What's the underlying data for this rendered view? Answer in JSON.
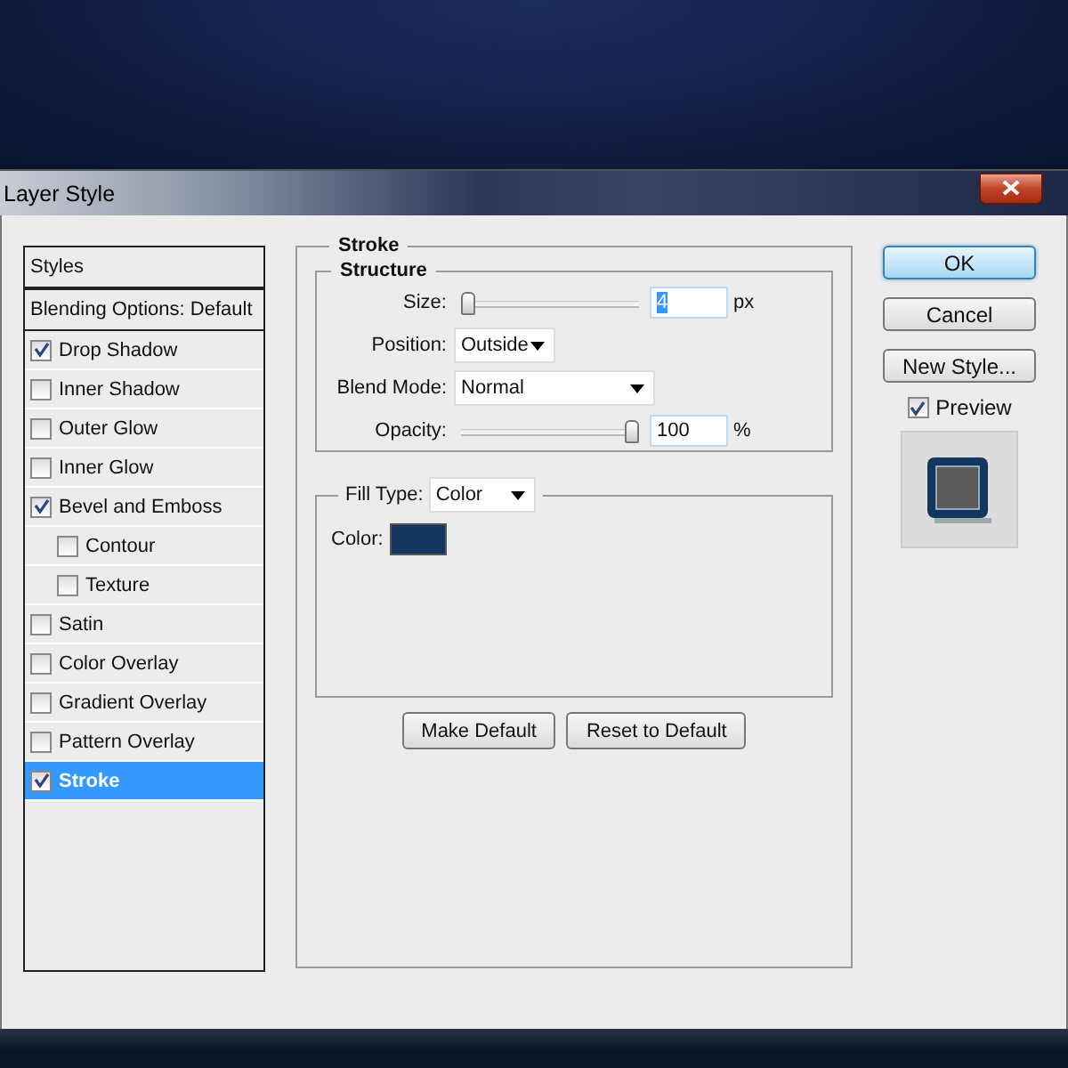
{
  "window": {
    "title": "Layer Style"
  },
  "styles_list": {
    "items": [
      {
        "kind": "header",
        "label": "Styles",
        "selected": false
      },
      {
        "kind": "option",
        "label": "Blending Options: Default",
        "selected": false
      },
      {
        "kind": "effect",
        "label": "Drop Shadow",
        "checked": true,
        "selected": false
      },
      {
        "kind": "effect",
        "label": "Inner Shadow",
        "checked": false,
        "selected": false
      },
      {
        "kind": "effect",
        "label": "Outer Glow",
        "checked": false,
        "selected": false
      },
      {
        "kind": "effect",
        "label": "Inner Glow",
        "checked": false,
        "selected": false
      },
      {
        "kind": "effect",
        "label": "Bevel and Emboss",
        "checked": true,
        "selected": false,
        "children": [
          {
            "kind": "effect",
            "label": "Contour",
            "checked": false,
            "selected": false
          },
          {
            "kind": "effect",
            "label": "Texture",
            "checked": false,
            "selected": false
          }
        ]
      },
      {
        "kind": "effect",
        "label": "Satin",
        "checked": false,
        "selected": false
      },
      {
        "kind": "effect",
        "label": "Color Overlay",
        "checked": false,
        "selected": false
      },
      {
        "kind": "effect",
        "label": "Gradient Overlay",
        "checked": false,
        "selected": false
      },
      {
        "kind": "effect",
        "label": "Pattern Overlay",
        "checked": false,
        "selected": false
      },
      {
        "kind": "effect",
        "label": "Stroke",
        "checked": true,
        "selected": true
      }
    ]
  },
  "stroke": {
    "title": "Stroke",
    "structure": {
      "title": "Structure",
      "size": {
        "label": "Size:",
        "level": 0.0,
        "value": "4",
        "unit": "px"
      },
      "position": {
        "label": "Position:",
        "value": "Outside"
      },
      "blend_mode": {
        "label": "Blend Mode:",
        "value": "Normal"
      },
      "opacity": {
        "label": "Opacity:",
        "level": 1.0,
        "value": "100",
        "unit": "%"
      }
    },
    "fill": {
      "label": "Fill Type:",
      "value": "Color",
      "color_label": "Color:",
      "color": "#12365e"
    },
    "buttons": [
      "Make Default",
      "Reset to Default"
    ]
  },
  "actions": [
    {
      "label": "OK",
      "default": true
    },
    {
      "label": "Cancel",
      "default": false
    },
    {
      "label": "New Style...",
      "default": false
    }
  ],
  "preview": {
    "label": "Preview",
    "checked": true
  }
}
